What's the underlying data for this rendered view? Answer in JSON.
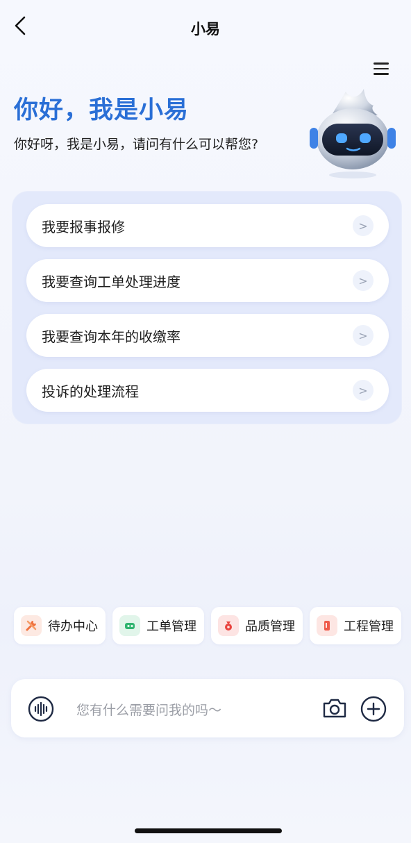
{
  "nav": {
    "title": "小易",
    "back_icon": "chevron-left-icon"
  },
  "menu_icon": "hamburger-menu-icon",
  "greeting": {
    "title": "你好，我是小易",
    "subtitle": "你好呀，我是小易，请问有什么可以帮您?"
  },
  "suggestions": [
    {
      "label": "我要报事报修"
    },
    {
      "label": "我要查询工单处理进度"
    },
    {
      "label": "我要查询本年的收缴率"
    },
    {
      "label": "投诉的处理流程"
    }
  ],
  "shortcuts": [
    {
      "label": "待办中心",
      "icon": "tools-icon",
      "color": "#f0723f"
    },
    {
      "label": "工单管理",
      "icon": "ticket-icon",
      "color": "#2fb46f"
    },
    {
      "label": "品质管理",
      "icon": "quality-bag-icon",
      "color": "#e9443f"
    },
    {
      "label": "工程管理",
      "icon": "engineering-icon",
      "color": "#ef5a4a"
    }
  ],
  "input": {
    "placeholder": "您有什么需要问我的吗～",
    "voice_icon": "voice-wave-icon",
    "camera_icon": "camera-icon",
    "add_icon": "plus-circle-icon"
  },
  "colors": {
    "accent": "#2a6fd6",
    "panel": "#e3e9fb"
  }
}
